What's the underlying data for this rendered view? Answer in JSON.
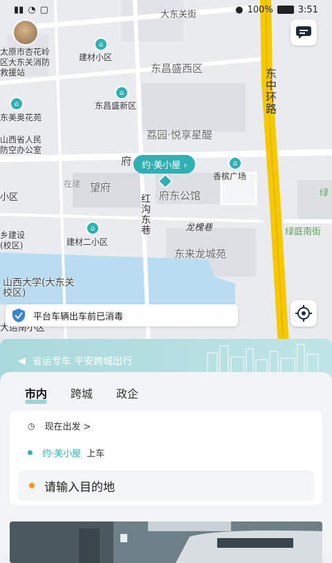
{
  "status": {
    "battery": "100%",
    "time": "3:51"
  },
  "map": {
    "streets": {
      "dadong": "大东关街",
      "dongzhong": "东中环路",
      "hongou": "红沟东巷",
      "longhuai": "龙槐巷",
      "fu": "府",
      "lvting": "绿庭南街",
      "lv": "绿"
    },
    "areas": {
      "dongchang_west": "东昌盛西区",
      "liyuan": "荔园·悦享星醍",
      "fudong": "府东公馆",
      "donglai": "东来龙城苑",
      "wangfu": "望府",
      "zaijian": "在建",
      "xiao": "小区",
      "univ": "山西大学(大东关校区)",
      "daonnan": "大运南小区"
    },
    "pois": {
      "fire_station": "太原市杏花岭区大东关消防救援站",
      "jiancai": "建材小区",
      "dongchang_new": "东昌盛新区",
      "dongmei": "东美奥花苑",
      "renfang": "山西省人民防空办公室",
      "xiangbin": "香槟广场",
      "jiancai2": "建材二小区",
      "construction": "乡建设(校区)"
    },
    "current_location": "约·美小屋"
  },
  "notice": {
    "text": "平台车辆出车前已消毒"
  },
  "banner": {
    "text": "省运专车 平安跨城出行"
  },
  "tabs": [
    "市内",
    "跨城",
    "政企"
  ],
  "form": {
    "time_label": "现在出发 >",
    "origin_name": "约·美小屋",
    "origin_suffix": "上车",
    "dest_placeholder": "请输入目的地"
  },
  "colors": {
    "accent": "#2fb0b4",
    "highway": "#f5c800",
    "dest_dot": "#f39a1e"
  }
}
